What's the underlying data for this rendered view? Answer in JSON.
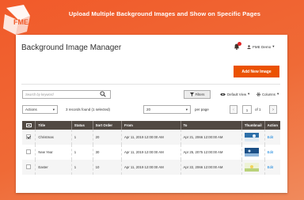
{
  "banner": {
    "title": "Upload Multiple Background Images and Show on Specific Pages",
    "logo_text": "FME"
  },
  "header": {
    "page_title": "Background Image Manager",
    "user_name": "FME Demo",
    "user_caret": "▾",
    "add_button": "Add New Image"
  },
  "toolbar": {
    "search_placeholder": "Search by keyword",
    "filters_label": "Filters",
    "view_label": "Default View",
    "columns_label": "Columns",
    "caret": "▾",
    "actions_label": "Actions",
    "records_text": "3 records found (1 selected)",
    "per_page_value": "20",
    "per_page_label": "per page",
    "page_prev": "‹",
    "page_current": "1",
    "page_of": "of 1",
    "page_next": "›"
  },
  "table": {
    "headers": {
      "select": "",
      "title": "Title",
      "status": "Status",
      "sort_order": "Sort Order",
      "from": "From",
      "to": "To",
      "thumbnail": "Thumbnail",
      "action": "Action"
    },
    "rows": [
      {
        "checked": true,
        "title": "Christmas",
        "status": "1",
        "sort_order": "20",
        "from": "Apr 11, 2019 12:00:00 AM",
        "to": "Apr 21, 2066 12:00:00 AM",
        "action": "Edit"
      },
      {
        "checked": false,
        "title": "New Year",
        "status": "1",
        "sort_order": "30",
        "from": "Apr 11, 2019 12:00:00 AM",
        "to": "Apr 25, 2075 12:00:00 AM",
        "action": "Edit"
      },
      {
        "checked": false,
        "title": "Easter",
        "status": "1",
        "sort_order": "10",
        "from": "Apr 11, 2019 12:00:00 AM",
        "to": "Apr 22, 2066 12:00:00 AM",
        "action": "Edit"
      }
    ]
  },
  "colors": {
    "banner": "#f15a2a",
    "add_button": "#eb5202",
    "table_header": "#514943",
    "link": "#007bdb",
    "notification_badge": "#e22626"
  },
  "icons": {
    "search": "search-icon",
    "filters": "funnel-icon",
    "view": "eye-icon",
    "columns": "gear-icon",
    "notifications": "bell-icon",
    "user": "user-icon"
  }
}
